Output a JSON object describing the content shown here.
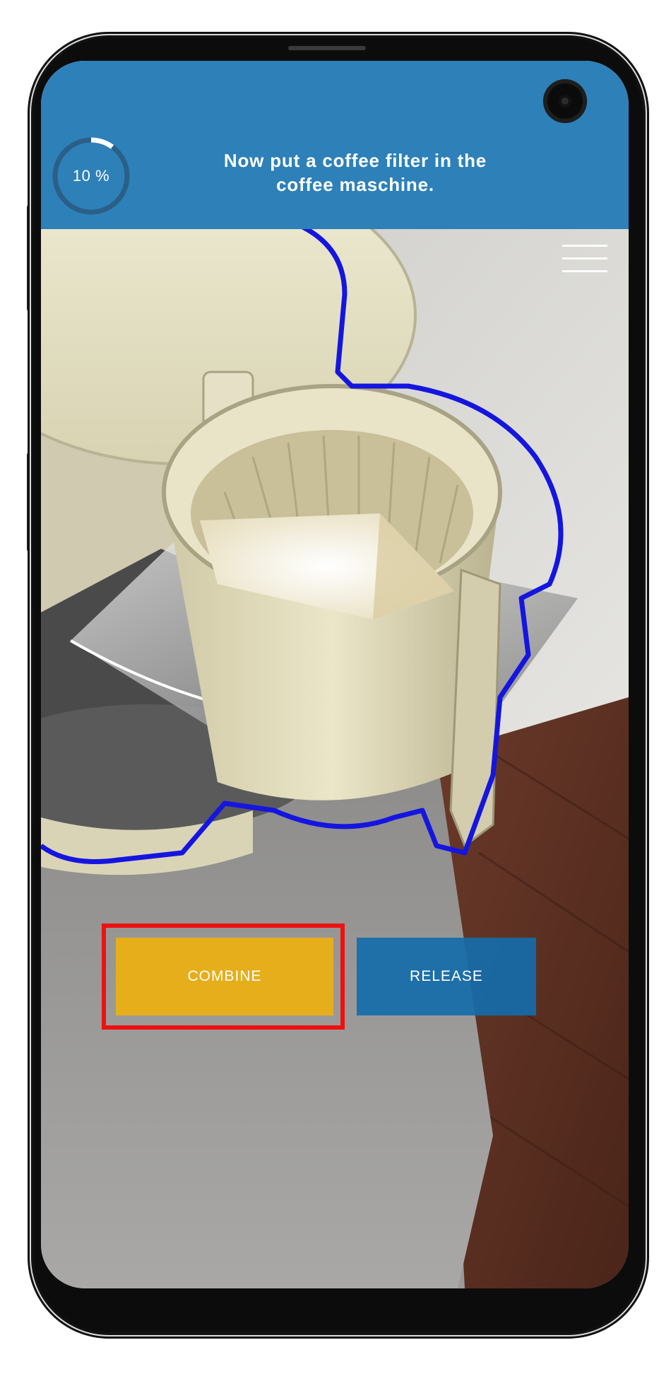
{
  "header": {
    "progress": {
      "percent": 10,
      "label": "10 %"
    },
    "instruction_line1": "Now put a coffee filter in the",
    "instruction_line2": "coffee maschine."
  },
  "actions": {
    "combine_label": "COMBINE",
    "release_label": "RELEASE"
  },
  "colors": {
    "header_background": "#2e80b8",
    "combine_button": "#eeb010",
    "release_button": "#166caa",
    "selection_outline": "#1515e0",
    "highlight_box": "#ee1111"
  },
  "icons": {
    "camera": "front-camera-icon",
    "menu": "hamburger-menu-icon"
  }
}
